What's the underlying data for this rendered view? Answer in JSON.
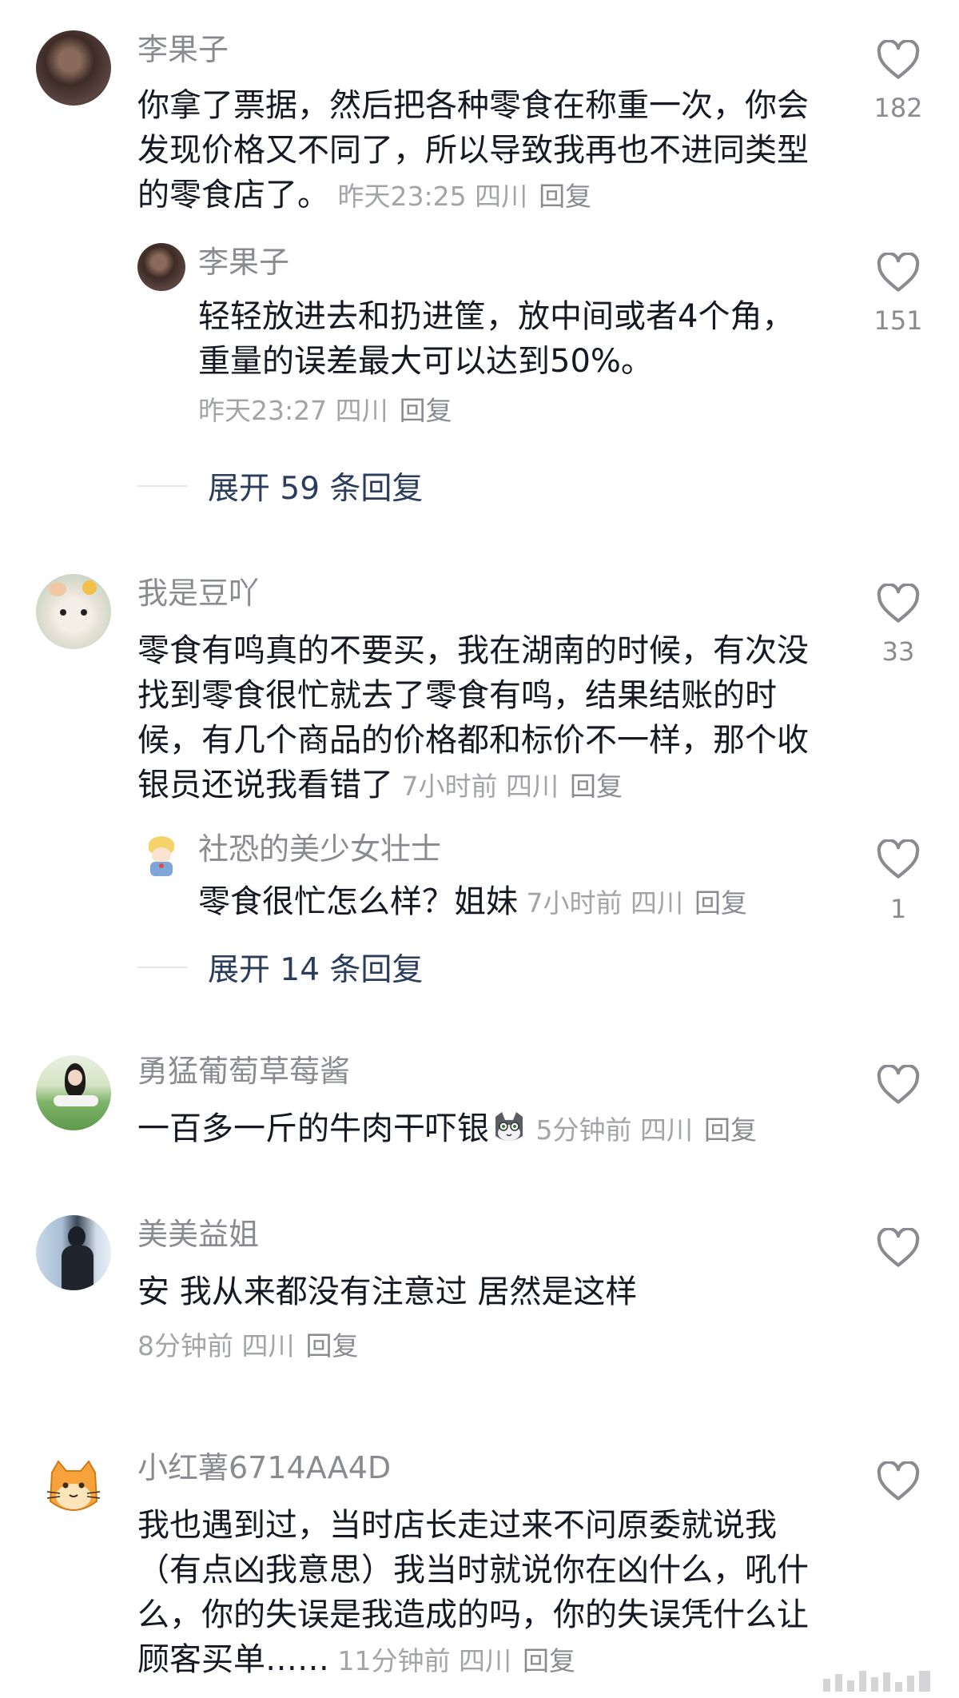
{
  "comments": [
    {
      "author": "李果子",
      "text": "你拿了票据，然后把各种零食在称重一次，你会发现价格又不同了，所以导致我再也不进同类型的零食店了。",
      "time_loc": "昨天23:25 四川",
      "reply": "回复",
      "likes": "182",
      "replies": [
        {
          "author": "李果子",
          "text": "轻轻放进去和扔进筐，放中间或者4个角，重量的误差最大可以达到50%。",
          "time_loc": "昨天23:27 四川",
          "reply": "回复",
          "likes": "151"
        }
      ],
      "expand": "展开 59 条回复"
    },
    {
      "author": "我是豆吖",
      "text": "零食有鸣真的不要买，我在湖南的时候，有次没找到零食很忙就去了零食有鸣，结果结账的时候，有几个商品的价格都和标价不一样，那个收银员还说我看错了",
      "time_loc": "7小时前 四川",
      "reply": "回复",
      "likes": "33",
      "replies": [
        {
          "author": "社恐的美少女壮士",
          "text": "零食很忙怎么样？姐妹",
          "time_loc": "7小时前 四川",
          "reply": "回复",
          "likes": "1"
        }
      ],
      "expand": "展开 14 条回复"
    },
    {
      "author": "勇猛葡萄草莓酱",
      "text": "一百多一斤的牛肉干吓银",
      "time_loc": "5分钟前 四川",
      "reply": "回复",
      "likes": ""
    },
    {
      "author": "美美益姐",
      "text": "安 我从来都没有注意过 居然是这样",
      "time_loc": "8分钟前 四川",
      "reply": "回复",
      "likes": ""
    },
    {
      "author": "小红薯6714AA4D",
      "text": "我也遇到过，当时店长走过来不问原委就说我（有点凶我意思）我当时就说你在凶什么，吼什么，你的失误是我造成的吗，你的失误凭什么让顾客买单……",
      "time_loc": "11分钟前 四川",
      "reply": "回复",
      "likes": ""
    }
  ],
  "icons": {
    "like": "heart-outline-icon",
    "emoji": "cat-face-emoji"
  },
  "colors": {
    "name": "#8a8b91",
    "text": "#161823",
    "meta": "#a3a4a8",
    "expand": "#2a3d5c"
  }
}
